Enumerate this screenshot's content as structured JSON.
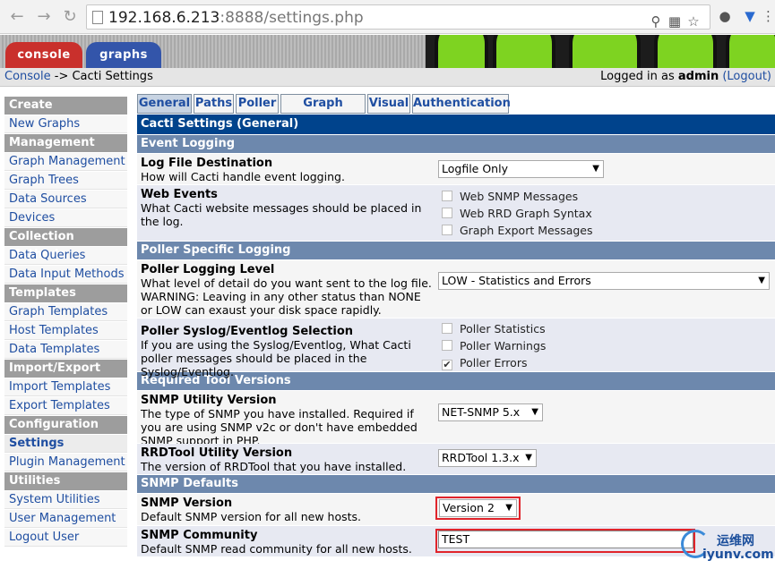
{
  "browser": {
    "url_host": "192.168.6.213",
    "url_rest": ":8888/settings.php"
  },
  "header": {
    "console_tab": "console",
    "graphs_tab": "graphs"
  },
  "breadcrumb": {
    "root": "Console",
    "separator": "->",
    "current": "Cacti Settings",
    "logged_in_prefix": "Logged in as",
    "user": "admin",
    "logout": "(Logout)"
  },
  "sidebar": {
    "groups": [
      {
        "title": "Create",
        "items": [
          "New Graphs"
        ]
      },
      {
        "title": "Management",
        "items": [
          "Graph Management",
          "Graph Trees",
          "Data Sources",
          "Devices"
        ]
      },
      {
        "title": "Collection Methods",
        "items": [
          "Data Queries",
          "Data Input Methods"
        ]
      },
      {
        "title": "Templates",
        "items": [
          "Graph Templates",
          "Host Templates",
          "Data Templates"
        ]
      },
      {
        "title": "Import/Export",
        "items": [
          "Import Templates",
          "Export Templates"
        ]
      },
      {
        "title": "Configuration",
        "items": [
          "Settings",
          "Plugin Management"
        ]
      },
      {
        "title": "Utilities",
        "items": [
          "System Utilities",
          "User Management",
          "Logout User"
        ]
      }
    ]
  },
  "tabs": [
    "General",
    "Paths",
    "Poller",
    "Graph Export",
    "Visual",
    "Authentication"
  ],
  "main": {
    "title": "Cacti Settings (General)",
    "sections": {
      "event_logging": "Event Logging",
      "poller_logging": "Poller Specific Logging",
      "tool_versions": "Required Tool Versions",
      "snmp_defaults": "SNMP Defaults"
    },
    "log_file": {
      "label": "Log File Destination",
      "desc": "How will Cacti handle event logging.",
      "value": "Logfile Only"
    },
    "web_events": {
      "label": "Web Events",
      "desc": "What Cacti website messages should be placed in the log.",
      "opt1": "Web SNMP Messages",
      "opt2": "Web RRD Graph Syntax",
      "opt3": "Graph Export Messages"
    },
    "poller_level": {
      "label": "Poller Logging Level",
      "desc": "What level of detail do you want sent to the log file. WARNING: Leaving in any other status than NONE or LOW can exaust your disk space rapidly.",
      "value": "LOW - Statistics and Errors"
    },
    "poller_syslog": {
      "label": "Poller Syslog/Eventlog Selection",
      "desc": "If you are using the Syslog/Eventlog, What Cacti poller messages should be placed in the Syslog/Eventlog.",
      "opt1": "Poller Statistics",
      "opt2": "Poller Warnings",
      "opt3": "Poller Errors"
    },
    "snmp_utility": {
      "label": "SNMP Utility Version",
      "desc": "The type of SNMP you have installed. Required if you are using SNMP v2c or don't have embedded SNMP support in PHP.",
      "value": "NET-SNMP 5.x"
    },
    "rrdtool": {
      "label": "RRDTool Utility Version",
      "desc": "The version of RRDTool that you have installed.",
      "value": "RRDTool 1.3.x"
    },
    "snmp_version": {
      "label": "SNMP Version",
      "desc": "Default SNMP version for all new hosts.",
      "value": "Version 2"
    },
    "snmp_community": {
      "label": "SNMP Community",
      "desc": "Default SNMP read community for all new hosts.",
      "value": "TEST"
    }
  },
  "watermark": {
    "line1": "运维网",
    "line2": "iyunv.com"
  },
  "colors": {
    "title_bar": "#00438c",
    "section_bar": "#6d88ad",
    "highlight": "#e0242b",
    "console_tab": "#c9302c",
    "graphs_tab": "#3355aa"
  }
}
